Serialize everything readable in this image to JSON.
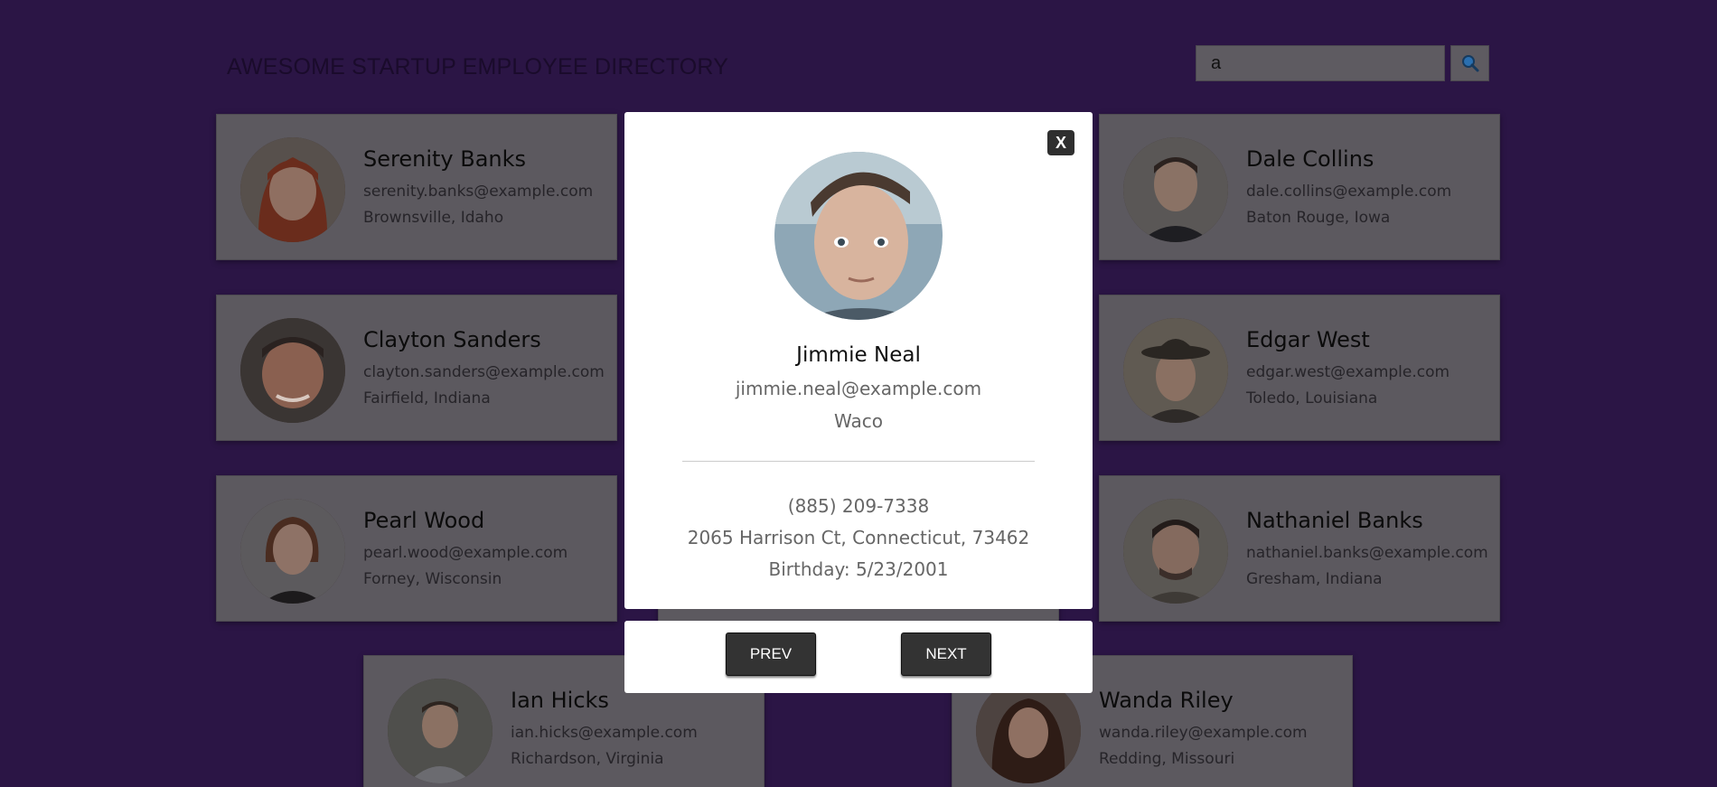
{
  "header": {
    "title": "AWESOME STARTUP EMPLOYEE DIRECTORY",
    "search_value": "a"
  },
  "cards": [
    {
      "name": "Serenity Banks",
      "email": "serenity.banks@example.com",
      "location": "Brownsville, Idaho"
    },
    {
      "name": "Dale Collins",
      "email": "dale.collins@example.com",
      "location": "Baton Rouge, Iowa"
    },
    {
      "name": "Clayton Sanders",
      "email": "clayton.sanders@example.com",
      "location": "Fairfield, Indiana"
    },
    {
      "name": "Edgar West",
      "email": "edgar.west@example.com",
      "location": "Toledo, Louisiana"
    },
    {
      "name": "Pearl Wood",
      "email": "pearl.wood@example.com",
      "location": "Forney, Wisconsin"
    },
    {
      "name": "Nathaniel Banks",
      "email": "nathaniel.banks@example.com",
      "location": "Gresham, Indiana"
    },
    {
      "name": "Ian Hicks",
      "email": "ian.hicks@example.com",
      "location": "Richardson, Virginia"
    },
    {
      "name": "Wanda Riley",
      "email": "wanda.riley@example.com",
      "location": "Redding, Missouri"
    }
  ],
  "modal": {
    "close_label": "X",
    "name": "Jimmie Neal",
    "email": "jimmie.neal@example.com",
    "city": "Waco",
    "phone": "(885) 209-7338",
    "address": "2065 Harrison Ct, Connecticut, 73462",
    "birthday": "Birthday: 5/23/2001",
    "prev_label": "PREV",
    "next_label": "NEXT"
  },
  "colors": {
    "background": "#2b1545",
    "card_overlay": "#5c595f",
    "modal": "#ffffff",
    "button": "#333333"
  }
}
